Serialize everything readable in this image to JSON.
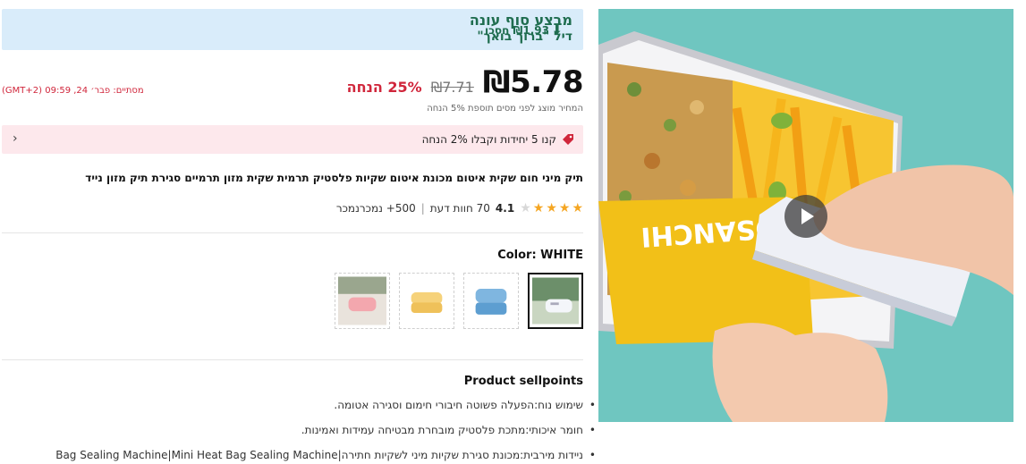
{
  "promo": {
    "title": "מבצע סוף עונה",
    "subtitle": "דיל \"ברוך בואך\"",
    "save_text": "₪1.93 חסכו"
  },
  "price": {
    "current": "₪5.78",
    "original": "₪7.71",
    "discount": "25% הנחה",
    "timer": "מסתיים:  פבר׳ 24, 09:59 (GMT+2)",
    "tax_note": "המחיר מוצג לפני מסים תוספת 5% הנחה"
  },
  "bundle": {
    "text": "קנו 5 יחידות וקבלו 2% הנחה",
    "chevron": "›"
  },
  "product": {
    "title": "תיק מיני חום שקית איטום מכונת איטום שקיות פלסטיק תרמית שקית מזון תרמיים סגירת תיק מזון נייד",
    "rating": "4.1",
    "stars_filled": 4,
    "reviews": "70 חוות דעת",
    "sold": "500+ נמכרנמכר"
  },
  "color": {
    "label": "Color: WHITE",
    "swatches": [
      {
        "name": "white",
        "selected": true
      },
      {
        "name": "blue",
        "selected": false
      },
      {
        "name": "yellow",
        "selected": false
      },
      {
        "name": "pink",
        "selected": false
      }
    ]
  },
  "sellpoints": {
    "title": "Product sellpoints",
    "items": [
      "שימוש נוח:הפעלה פשוטה  חיבורי חימום וסגירה אטומה.",
      "חומר איכותי:מתכת פלסטיק מובחרת מבטיחה עמידות ואמינות.",
      "ניידות מירבית:מכונת סגירת שקיות מיני לשקיות חתירה|Bag Sealing Machine|Mini Heat Bag Sealing Machine"
    ]
  },
  "media": {
    "bag_text": "OSANCHI",
    "background": "#6fc6c0"
  },
  "colors": {
    "promo_bg": "#d9ecfa",
    "promo_text": "#1f6d4f",
    "discount_red": "#d0263b",
    "bundle_bg": "#fde8ec",
    "star": "#f5a623"
  }
}
